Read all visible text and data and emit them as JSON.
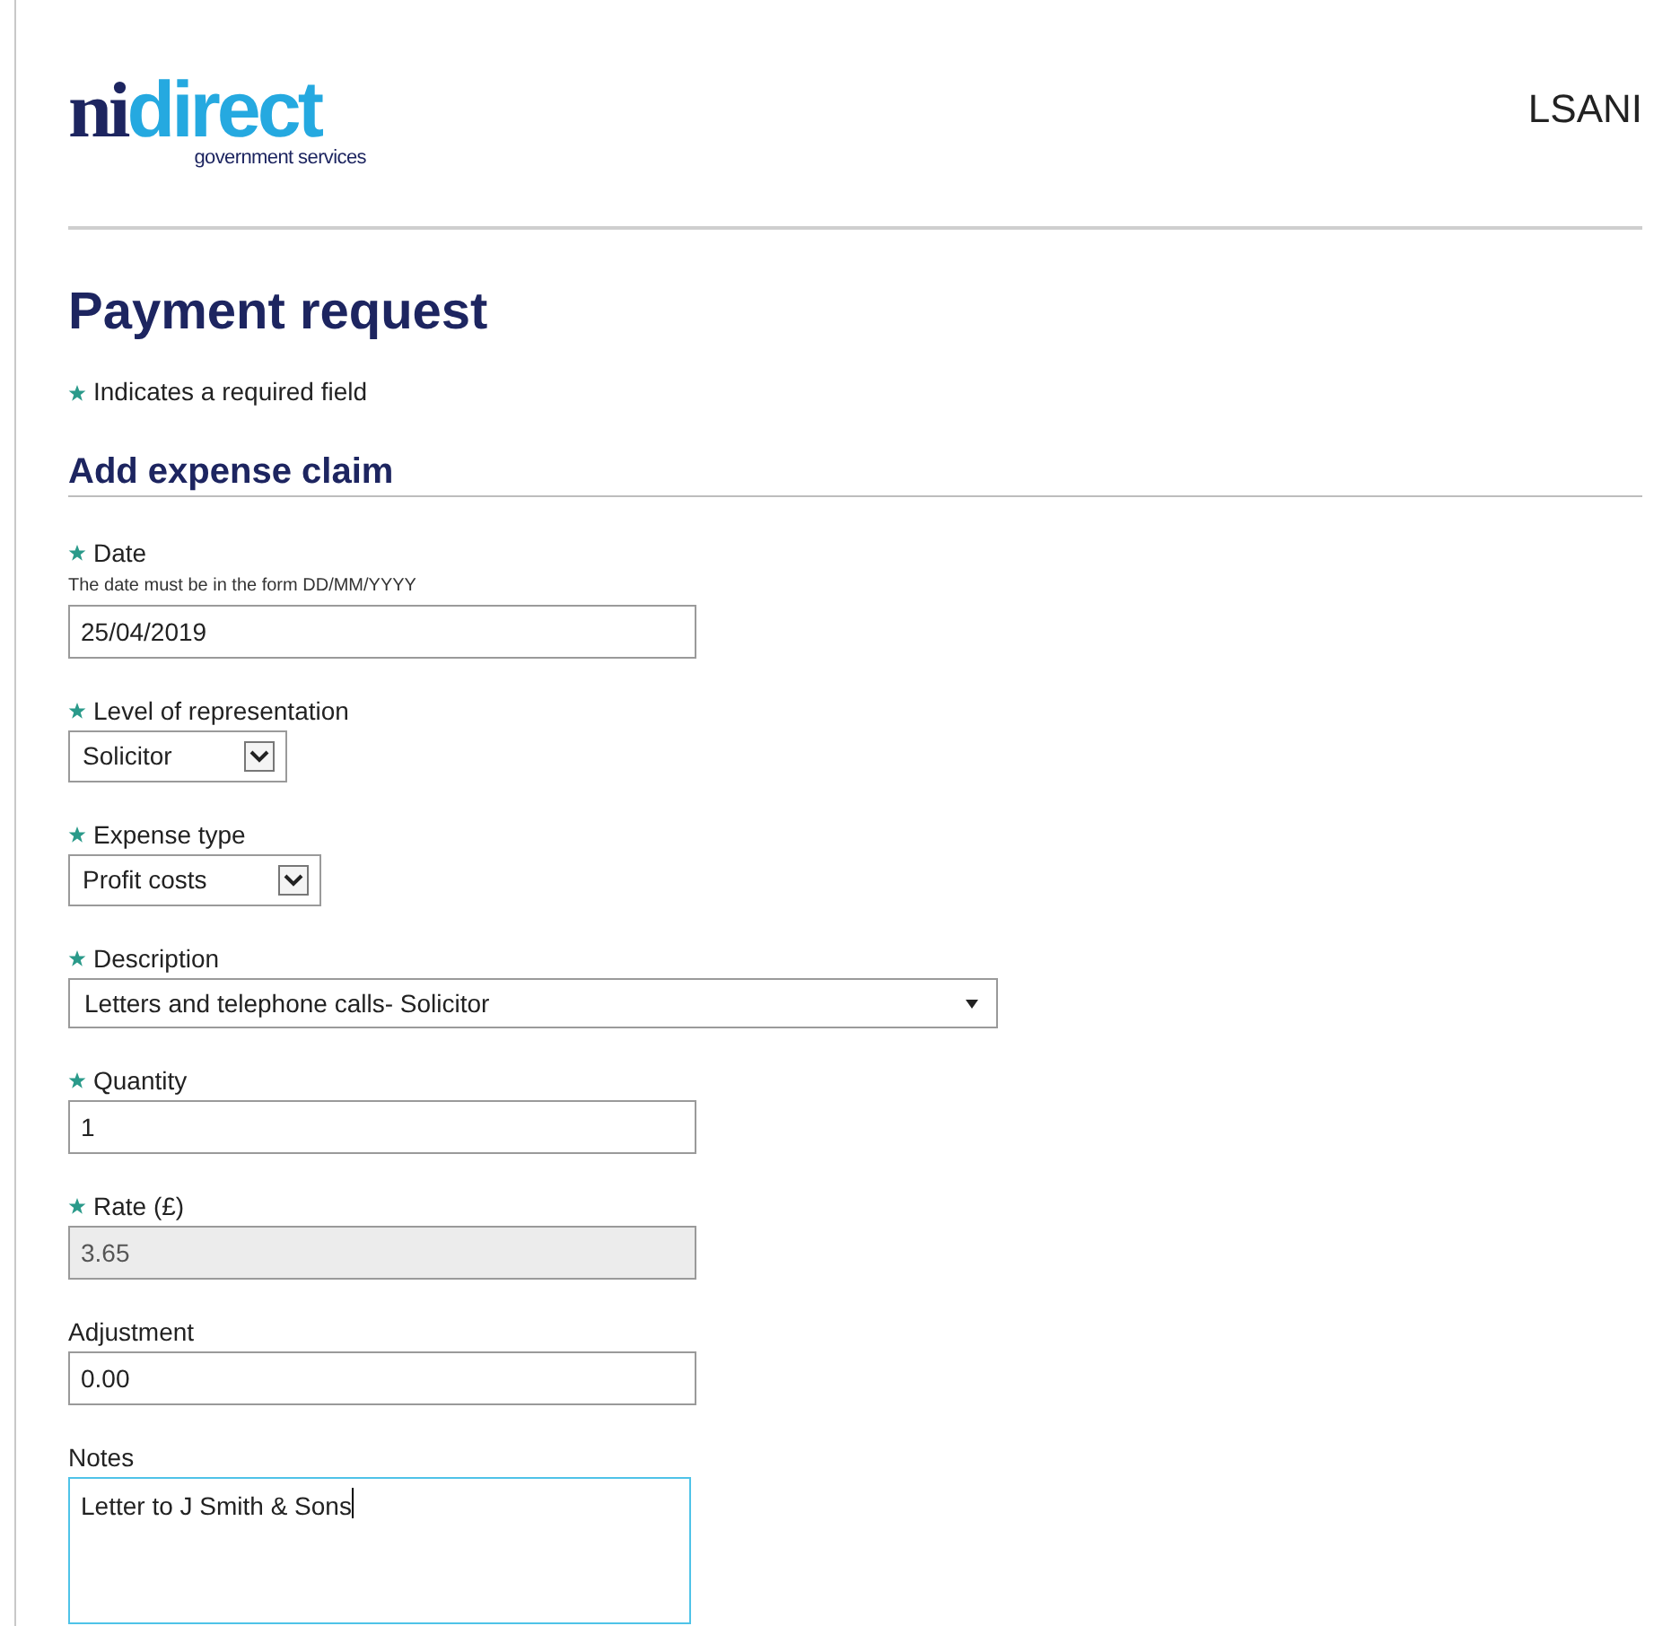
{
  "header": {
    "logo": {
      "primary": "ni",
      "secondary": "direct",
      "tagline": "government services"
    },
    "site_name": "LSANI"
  },
  "title": "Payment request",
  "required_note": "Indicates a required field",
  "section_title": "Add expense claim",
  "fields": [
    {
      "kind": "text",
      "label": "Date",
      "required": true,
      "hint": "The date must be in the form DD/MM/YYYY",
      "value": "25/04/2019",
      "disabled": false,
      "focused": false
    },
    {
      "kind": "select",
      "label": "Level of representation",
      "required": true,
      "value": "Solicitor",
      "disabled": false,
      "focused": false
    },
    {
      "kind": "select",
      "label": "Expense type",
      "required": true,
      "value": "Profit costs",
      "disabled": false,
      "focused": false
    },
    {
      "kind": "dropdown",
      "label": "Description",
      "required": true,
      "value": "Letters and telephone calls- Solicitor",
      "disabled": false,
      "focused": false
    },
    {
      "kind": "text",
      "label": "Quantity",
      "required": true,
      "value": "1",
      "disabled": false,
      "focused": false
    },
    {
      "kind": "text",
      "label": "Rate (£)",
      "required": true,
      "value": "3.65",
      "disabled": true,
      "focused": false
    },
    {
      "kind": "text",
      "label": "Adjustment",
      "required": false,
      "value": "0.00",
      "disabled": false,
      "focused": false
    },
    {
      "kind": "textarea",
      "label": "Notes",
      "required": false,
      "value": "Letter to J Smith & Sons",
      "disabled": false,
      "focused": true
    }
  ]
}
